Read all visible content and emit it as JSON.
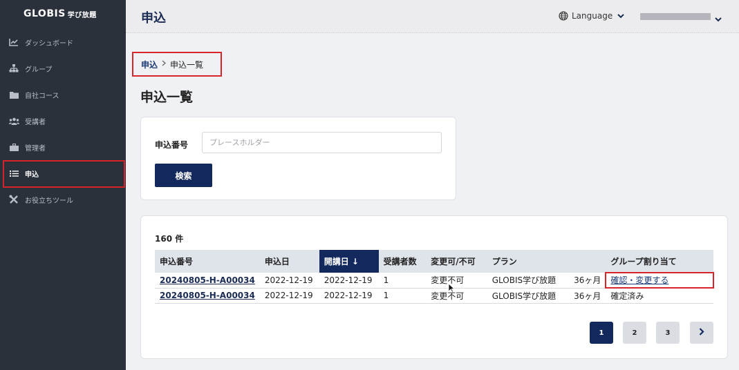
{
  "sidebar": {
    "logo": "GLOBIS",
    "logo_sub": "学び放題",
    "items": [
      {
        "label": "ダッシュボード",
        "icon": "chart-icon"
      },
      {
        "label": "グループ",
        "icon": "hierarchy-icon"
      },
      {
        "label": "自社コース",
        "icon": "folder-icon"
      },
      {
        "label": "受講者",
        "icon": "users-icon"
      },
      {
        "label": "管理者",
        "icon": "briefcase-icon"
      },
      {
        "label": "申込",
        "icon": "list-icon",
        "active": true
      },
      {
        "label": "お役立ちツール",
        "icon": "tools-icon"
      }
    ]
  },
  "header": {
    "title": "申込",
    "language_label": "Language"
  },
  "breadcrumb": {
    "parent": "申込",
    "current": "申込一覧"
  },
  "page": {
    "heading": "申込一覧"
  },
  "search": {
    "label": "申込番号",
    "value": "",
    "placeholder": "プレースホルダー",
    "button": "検索"
  },
  "results": {
    "count": "160 件",
    "columns": [
      "申込番号",
      "申込日",
      "開講日",
      "受講者数",
      "変更可/不可",
      "プラン",
      "",
      "グループ割り当て"
    ],
    "sort_arrow": "↓",
    "rows": [
      {
        "no": "20240805-H-A00034",
        "applied": "2022-12-19",
        "start": "2022-12-19",
        "count": "1",
        "changeable": "変更不可",
        "plan": "GLOBIS学び放題",
        "term": "36ヶ月",
        "assign": "確認・変更する",
        "assign_link": true
      },
      {
        "no": "20240805-H-A00034",
        "applied": "2022-12-19",
        "start": "2022-12-19",
        "count": "1",
        "changeable": "変更不可",
        "plan": "GLOBIS学び放題",
        "term": "36ヶ月",
        "assign": "確定済み",
        "assign_link": false
      }
    ]
  },
  "pagination": {
    "pages": [
      "1",
      "2",
      "3"
    ],
    "current": "1",
    "next": "›"
  },
  "colors": {
    "sidebar": "#2b313b",
    "primary": "#13295d",
    "highlight": "#d8232a"
  }
}
